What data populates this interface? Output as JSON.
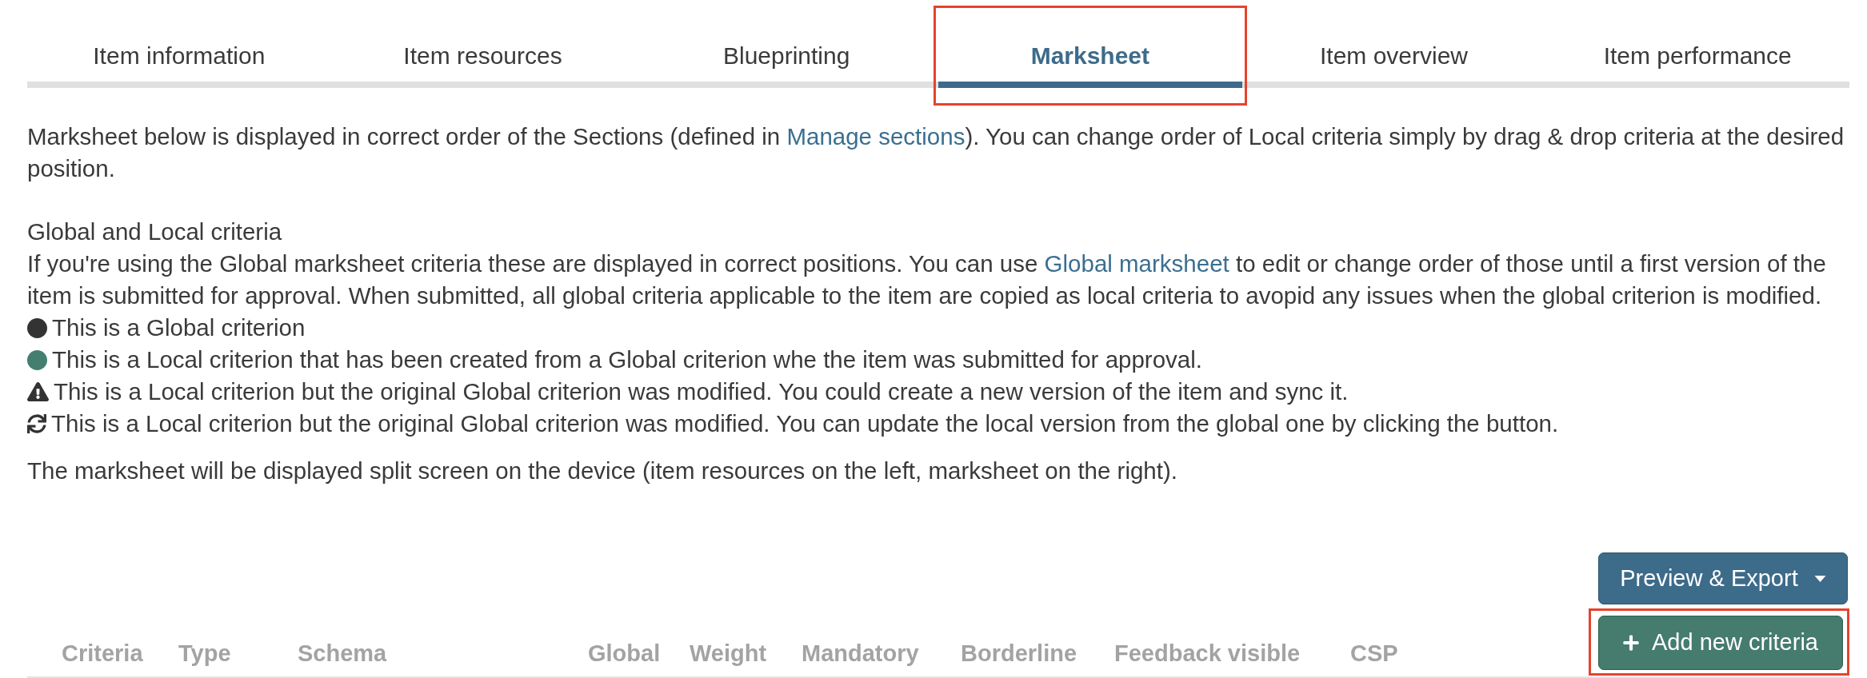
{
  "tabs": [
    {
      "label": "Item information",
      "selected": false,
      "highlighted": false
    },
    {
      "label": "Item resources",
      "selected": false,
      "highlighted": false
    },
    {
      "label": "Blueprinting",
      "selected": false,
      "highlighted": false
    },
    {
      "label": "Marksheet",
      "selected": true,
      "highlighted": true
    },
    {
      "label": "Item overview",
      "selected": false,
      "highlighted": false
    },
    {
      "label": "Item performance",
      "selected": false,
      "highlighted": false
    }
  ],
  "intro": {
    "text_before": "Marksheet below is displayed in correct order of the Sections (defined in ",
    "link": "Manage sections",
    "text_after": "). You can change order of Local criteria simply by drag & drop criteria at the desired position."
  },
  "criteria_info": {
    "heading": "Global and Local criteria",
    "text_before": "If you're using the Global marksheet criteria these are displayed in correct positions. You can use ",
    "link": "Global marksheet",
    "text_after": " to edit or change order of those until a first version of the item is submitted for approval. When submitted, all global criteria applicable to the item are copied as local criteria to avopid any issues when the global criterion is modified."
  },
  "legend": [
    {
      "kind": "dot",
      "color": "#333333",
      "text": "This is a Global criterion"
    },
    {
      "kind": "dot",
      "color": "#437e6f",
      "text": "This is a Local criterion that has been created from a Global criterion whe the item was submitted for approval."
    },
    {
      "kind": "warning",
      "text": "This is a Local criterion but the original Global criterion was modified. You could create a new version of the item and sync it."
    },
    {
      "kind": "sync",
      "text": "This is a Local criterion but the original Global criterion was modified. You can update the local version from the global one by clicking the button."
    }
  ],
  "layout_note": "The marksheet will be displayed split screen on the device (item resources on the left, marksheet on the right).",
  "preview_export": {
    "label": "Preview & Export"
  },
  "table": {
    "columns": [
      "Criteria",
      "Type",
      "Schema",
      "Global",
      "Weight",
      "Mandatory",
      "Borderline",
      "Feedback visible",
      "CSP"
    ],
    "add_button": {
      "label": "Add new criteria",
      "highlighted": true
    }
  }
}
